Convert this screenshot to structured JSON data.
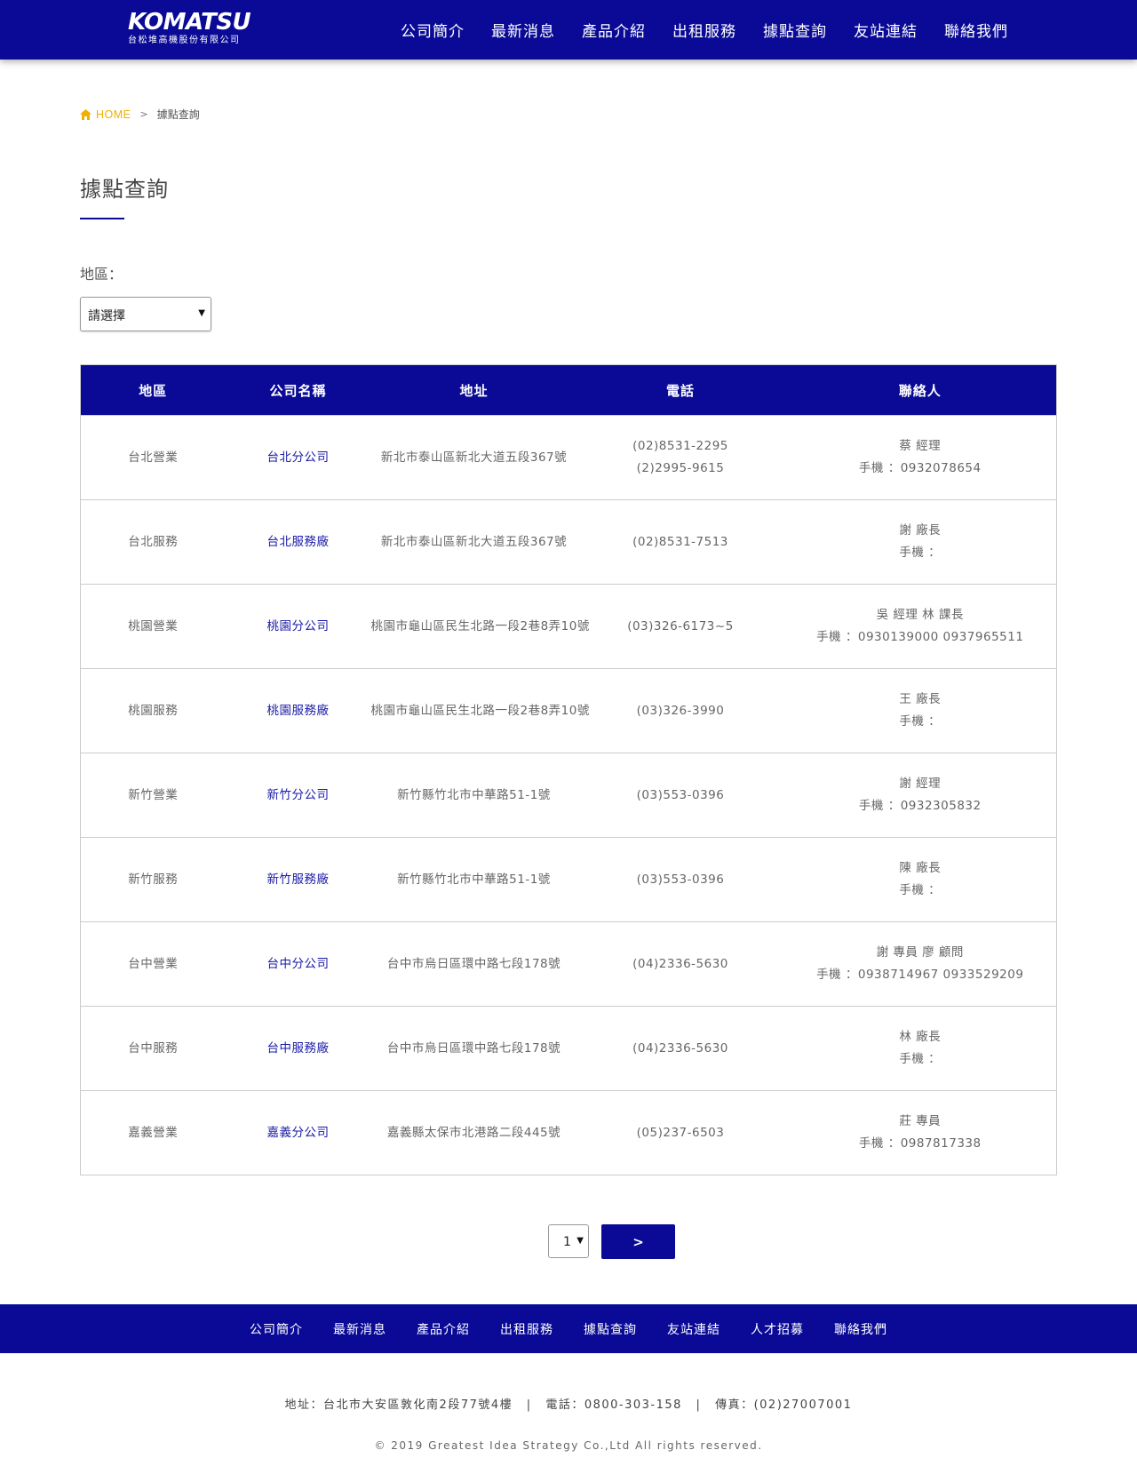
{
  "header": {
    "logo_main": "KOMATSU",
    "logo_sub": "台松堆高機股份有限公司",
    "nav": [
      "公司簡介",
      "最新消息",
      "產品介紹",
      "出租服務",
      "據點查詢",
      "友站連結",
      "聯絡我們"
    ]
  },
  "breadcrumb": {
    "home_icon": "home-icon",
    "home": "HOME",
    "separator": ">",
    "current": "據點查詢"
  },
  "page": {
    "title": "據點查詢"
  },
  "filter": {
    "label": "地區：",
    "selected": "請選擇"
  },
  "table": {
    "headers": [
      "地區",
      "公司名稱",
      "地址",
      "電話",
      "聯絡人"
    ],
    "rows": [
      {
        "region": "台北營業",
        "company": "台北分公司",
        "address": "新北市泰山區新北大道五段367號",
        "phone1": "(02)8531-2295",
        "phone2": "(2)2995-9615",
        "contact_name": "蔡 經理",
        "contact_mobile": "手機 ：0932078654"
      },
      {
        "region": "台北服務",
        "company": "台北服務廠",
        "address": "新北市泰山區新北大道五段367號",
        "phone1": "(02)8531-7513",
        "phone2": "",
        "contact_name": "謝 廠長",
        "contact_mobile": "手機 ："
      },
      {
        "region": "桃園營業",
        "company": "桃園分公司",
        "address": "桃園市龜山區民生北路一段2巷8弄10號",
        "phone1": "(03)326-6173~5",
        "phone2": "",
        "contact_name": "吳 經理 林 課長",
        "contact_mobile": "手機 ：0930139000 0937965511"
      },
      {
        "region": "桃園服務",
        "company": "桃園服務廠",
        "address": "桃園市龜山區民生北路一段2巷8弄10號",
        "phone1": "(03)326-3990",
        "phone2": "",
        "contact_name": "王 廠長",
        "contact_mobile": "手機 ："
      },
      {
        "region": "新竹營業",
        "company": "新竹分公司",
        "address": "新竹縣竹北市中華路51-1號",
        "phone1": "(03)553-0396",
        "phone2": "",
        "contact_name": "謝 經理",
        "contact_mobile": "手機 ：0932305832"
      },
      {
        "region": "新竹服務",
        "company": "新竹服務廠",
        "address": "新竹縣竹北市中華路51-1號",
        "phone1": "(03)553-0396",
        "phone2": "",
        "contact_name": "陳 廠長",
        "contact_mobile": "手機 ："
      },
      {
        "region": "台中營業",
        "company": "台中分公司",
        "address": "台中市烏日區環中路七段178號",
        "phone1": "(04)2336-5630",
        "phone2": "",
        "contact_name": "謝 專員 廖 顧問",
        "contact_mobile": "手機 ：0938714967 0933529209"
      },
      {
        "region": "台中服務",
        "company": "台中服務廠",
        "address": "台中市烏日區環中路七段178號",
        "phone1": "(04)2336-5630",
        "phone2": "",
        "contact_name": "林 廠長",
        "contact_mobile": "手機 ："
      },
      {
        "region": "嘉義營業",
        "company": "嘉義分公司",
        "address": "嘉義縣太保市北港路二段445號",
        "phone1": "(05)237-6503",
        "phone2": "",
        "contact_name": "莊 專員",
        "contact_mobile": "手機 ：0987817338"
      }
    ]
  },
  "pagination": {
    "page": "1",
    "next_label": ">"
  },
  "footer": {
    "nav": [
      "公司簡介",
      "最新消息",
      "產品介紹",
      "出租服務",
      "據點查詢",
      "友站連結",
      "人才招募",
      "聯絡我們"
    ],
    "address": "地址：台北市大安區敦化南2段77號4樓",
    "divider": "|",
    "phone": "電話：0800-303-158",
    "fax": "傳真：(02)27007001",
    "copyright": "© 2019 Greatest Idea Strategy Co.,Ltd All rights reserved."
  },
  "colors": {
    "brand_blue": "#0a0a96",
    "home_accent": "#f0b000",
    "link_blue": "#1a1aa8"
  }
}
